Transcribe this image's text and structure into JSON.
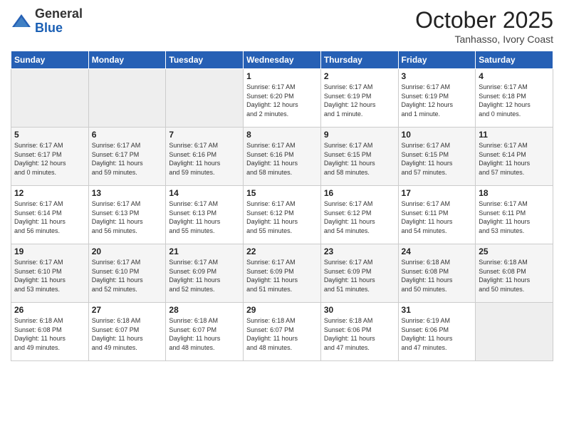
{
  "header": {
    "logo_general": "General",
    "logo_blue": "Blue",
    "title": "October 2025",
    "location": "Tanhasso, Ivory Coast"
  },
  "weekdays": [
    "Sunday",
    "Monday",
    "Tuesday",
    "Wednesday",
    "Thursday",
    "Friday",
    "Saturday"
  ],
  "weeks": [
    [
      {
        "day": "",
        "info": ""
      },
      {
        "day": "",
        "info": ""
      },
      {
        "day": "",
        "info": ""
      },
      {
        "day": "1",
        "info": "Sunrise: 6:17 AM\nSunset: 6:20 PM\nDaylight: 12 hours\nand 2 minutes."
      },
      {
        "day": "2",
        "info": "Sunrise: 6:17 AM\nSunset: 6:19 PM\nDaylight: 12 hours\nand 1 minute."
      },
      {
        "day": "3",
        "info": "Sunrise: 6:17 AM\nSunset: 6:19 PM\nDaylight: 12 hours\nand 1 minute."
      },
      {
        "day": "4",
        "info": "Sunrise: 6:17 AM\nSunset: 6:18 PM\nDaylight: 12 hours\nand 0 minutes."
      }
    ],
    [
      {
        "day": "5",
        "info": "Sunrise: 6:17 AM\nSunset: 6:17 PM\nDaylight: 12 hours\nand 0 minutes."
      },
      {
        "day": "6",
        "info": "Sunrise: 6:17 AM\nSunset: 6:17 PM\nDaylight: 11 hours\nand 59 minutes."
      },
      {
        "day": "7",
        "info": "Sunrise: 6:17 AM\nSunset: 6:16 PM\nDaylight: 11 hours\nand 59 minutes."
      },
      {
        "day": "8",
        "info": "Sunrise: 6:17 AM\nSunset: 6:16 PM\nDaylight: 11 hours\nand 58 minutes."
      },
      {
        "day": "9",
        "info": "Sunrise: 6:17 AM\nSunset: 6:15 PM\nDaylight: 11 hours\nand 58 minutes."
      },
      {
        "day": "10",
        "info": "Sunrise: 6:17 AM\nSunset: 6:15 PM\nDaylight: 11 hours\nand 57 minutes."
      },
      {
        "day": "11",
        "info": "Sunrise: 6:17 AM\nSunset: 6:14 PM\nDaylight: 11 hours\nand 57 minutes."
      }
    ],
    [
      {
        "day": "12",
        "info": "Sunrise: 6:17 AM\nSunset: 6:14 PM\nDaylight: 11 hours\nand 56 minutes."
      },
      {
        "day": "13",
        "info": "Sunrise: 6:17 AM\nSunset: 6:13 PM\nDaylight: 11 hours\nand 56 minutes."
      },
      {
        "day": "14",
        "info": "Sunrise: 6:17 AM\nSunset: 6:13 PM\nDaylight: 11 hours\nand 55 minutes."
      },
      {
        "day": "15",
        "info": "Sunrise: 6:17 AM\nSunset: 6:12 PM\nDaylight: 11 hours\nand 55 minutes."
      },
      {
        "day": "16",
        "info": "Sunrise: 6:17 AM\nSunset: 6:12 PM\nDaylight: 11 hours\nand 54 minutes."
      },
      {
        "day": "17",
        "info": "Sunrise: 6:17 AM\nSunset: 6:11 PM\nDaylight: 11 hours\nand 54 minutes."
      },
      {
        "day": "18",
        "info": "Sunrise: 6:17 AM\nSunset: 6:11 PM\nDaylight: 11 hours\nand 53 minutes."
      }
    ],
    [
      {
        "day": "19",
        "info": "Sunrise: 6:17 AM\nSunset: 6:10 PM\nDaylight: 11 hours\nand 53 minutes."
      },
      {
        "day": "20",
        "info": "Sunrise: 6:17 AM\nSunset: 6:10 PM\nDaylight: 11 hours\nand 52 minutes."
      },
      {
        "day": "21",
        "info": "Sunrise: 6:17 AM\nSunset: 6:09 PM\nDaylight: 11 hours\nand 52 minutes."
      },
      {
        "day": "22",
        "info": "Sunrise: 6:17 AM\nSunset: 6:09 PM\nDaylight: 11 hours\nand 51 minutes."
      },
      {
        "day": "23",
        "info": "Sunrise: 6:17 AM\nSunset: 6:09 PM\nDaylight: 11 hours\nand 51 minutes."
      },
      {
        "day": "24",
        "info": "Sunrise: 6:18 AM\nSunset: 6:08 PM\nDaylight: 11 hours\nand 50 minutes."
      },
      {
        "day": "25",
        "info": "Sunrise: 6:18 AM\nSunset: 6:08 PM\nDaylight: 11 hours\nand 50 minutes."
      }
    ],
    [
      {
        "day": "26",
        "info": "Sunrise: 6:18 AM\nSunset: 6:08 PM\nDaylight: 11 hours\nand 49 minutes."
      },
      {
        "day": "27",
        "info": "Sunrise: 6:18 AM\nSunset: 6:07 PM\nDaylight: 11 hours\nand 49 minutes."
      },
      {
        "day": "28",
        "info": "Sunrise: 6:18 AM\nSunset: 6:07 PM\nDaylight: 11 hours\nand 48 minutes."
      },
      {
        "day": "29",
        "info": "Sunrise: 6:18 AM\nSunset: 6:07 PM\nDaylight: 11 hours\nand 48 minutes."
      },
      {
        "day": "30",
        "info": "Sunrise: 6:18 AM\nSunset: 6:06 PM\nDaylight: 11 hours\nand 47 minutes."
      },
      {
        "day": "31",
        "info": "Sunrise: 6:19 AM\nSunset: 6:06 PM\nDaylight: 11 hours\nand 47 minutes."
      },
      {
        "day": "",
        "info": ""
      }
    ]
  ]
}
